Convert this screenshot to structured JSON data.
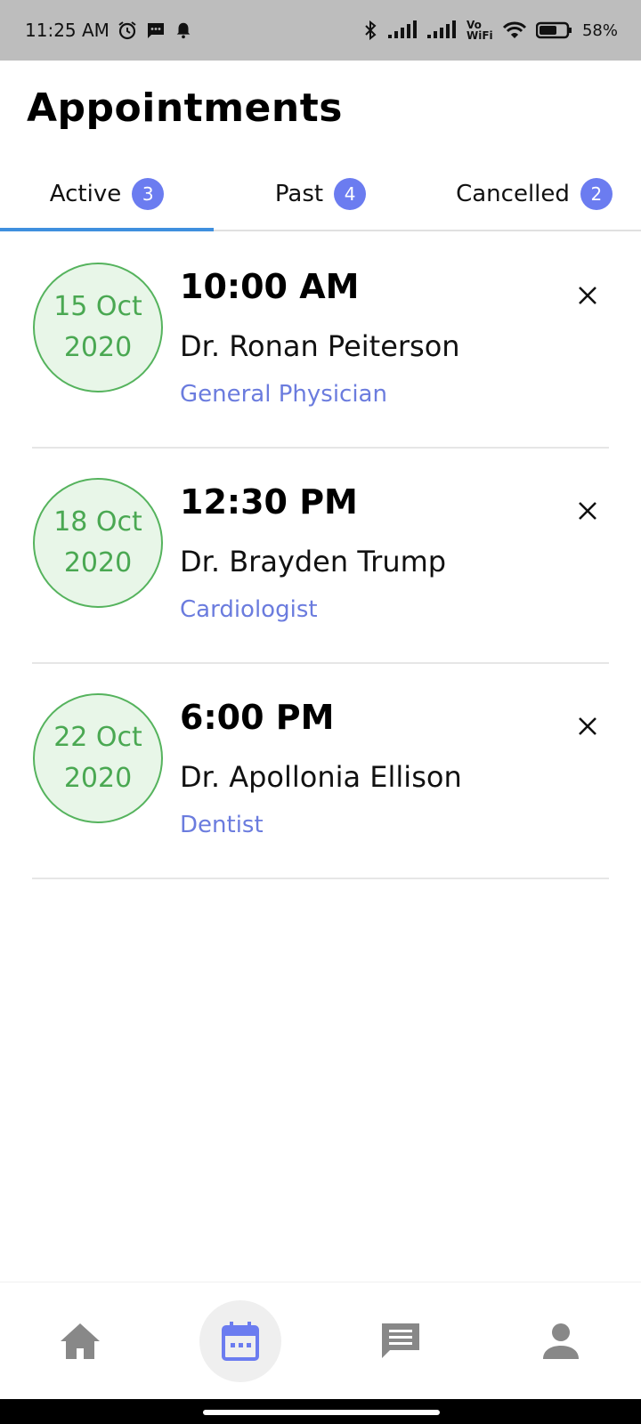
{
  "status_bar": {
    "time": "11:25 AM",
    "network_label": "Vo WiFi",
    "battery": "58%",
    "icons": [
      "alarm-icon",
      "message-icon",
      "notification-bell-icon",
      "bluetooth-icon",
      "signal-icon",
      "wifi-icon",
      "battery-icon"
    ]
  },
  "header": {
    "title": "Appointments"
  },
  "tabs": [
    {
      "label": "Active",
      "count": "3",
      "selected": true
    },
    {
      "label": "Past",
      "count": "4",
      "selected": false
    },
    {
      "label": "Cancelled",
      "count": "2",
      "selected": false
    }
  ],
  "appointments": [
    {
      "day": "15 Oct",
      "year": "2020",
      "time": "10:00 AM",
      "doctor": "Dr. Ronan Peiterson",
      "specialty": "General Physician"
    },
    {
      "day": "18 Oct",
      "year": "2020",
      "time": "12:30 PM",
      "doctor": "Dr. Brayden Trump",
      "specialty": "Cardiologist"
    },
    {
      "day": "22 Oct",
      "year": "2020",
      "time": "6:00 PM",
      "doctor": "Dr. Apollonia Ellison",
      "specialty": "Dentist"
    }
  ],
  "bottom_nav": {
    "items": [
      {
        "icon": "home-icon",
        "selected": false
      },
      {
        "icon": "calendar-icon",
        "selected": true
      },
      {
        "icon": "chat-icon",
        "selected": false
      },
      {
        "icon": "profile-icon",
        "selected": false
      }
    ]
  },
  "colors": {
    "accent": "#6b7cf0",
    "tab_indicator": "#3f8fde",
    "date_green": "#4aa852",
    "date_bg": "#e8f6e8",
    "specialty": "#6b7cde",
    "nav_icon": "#888888"
  }
}
